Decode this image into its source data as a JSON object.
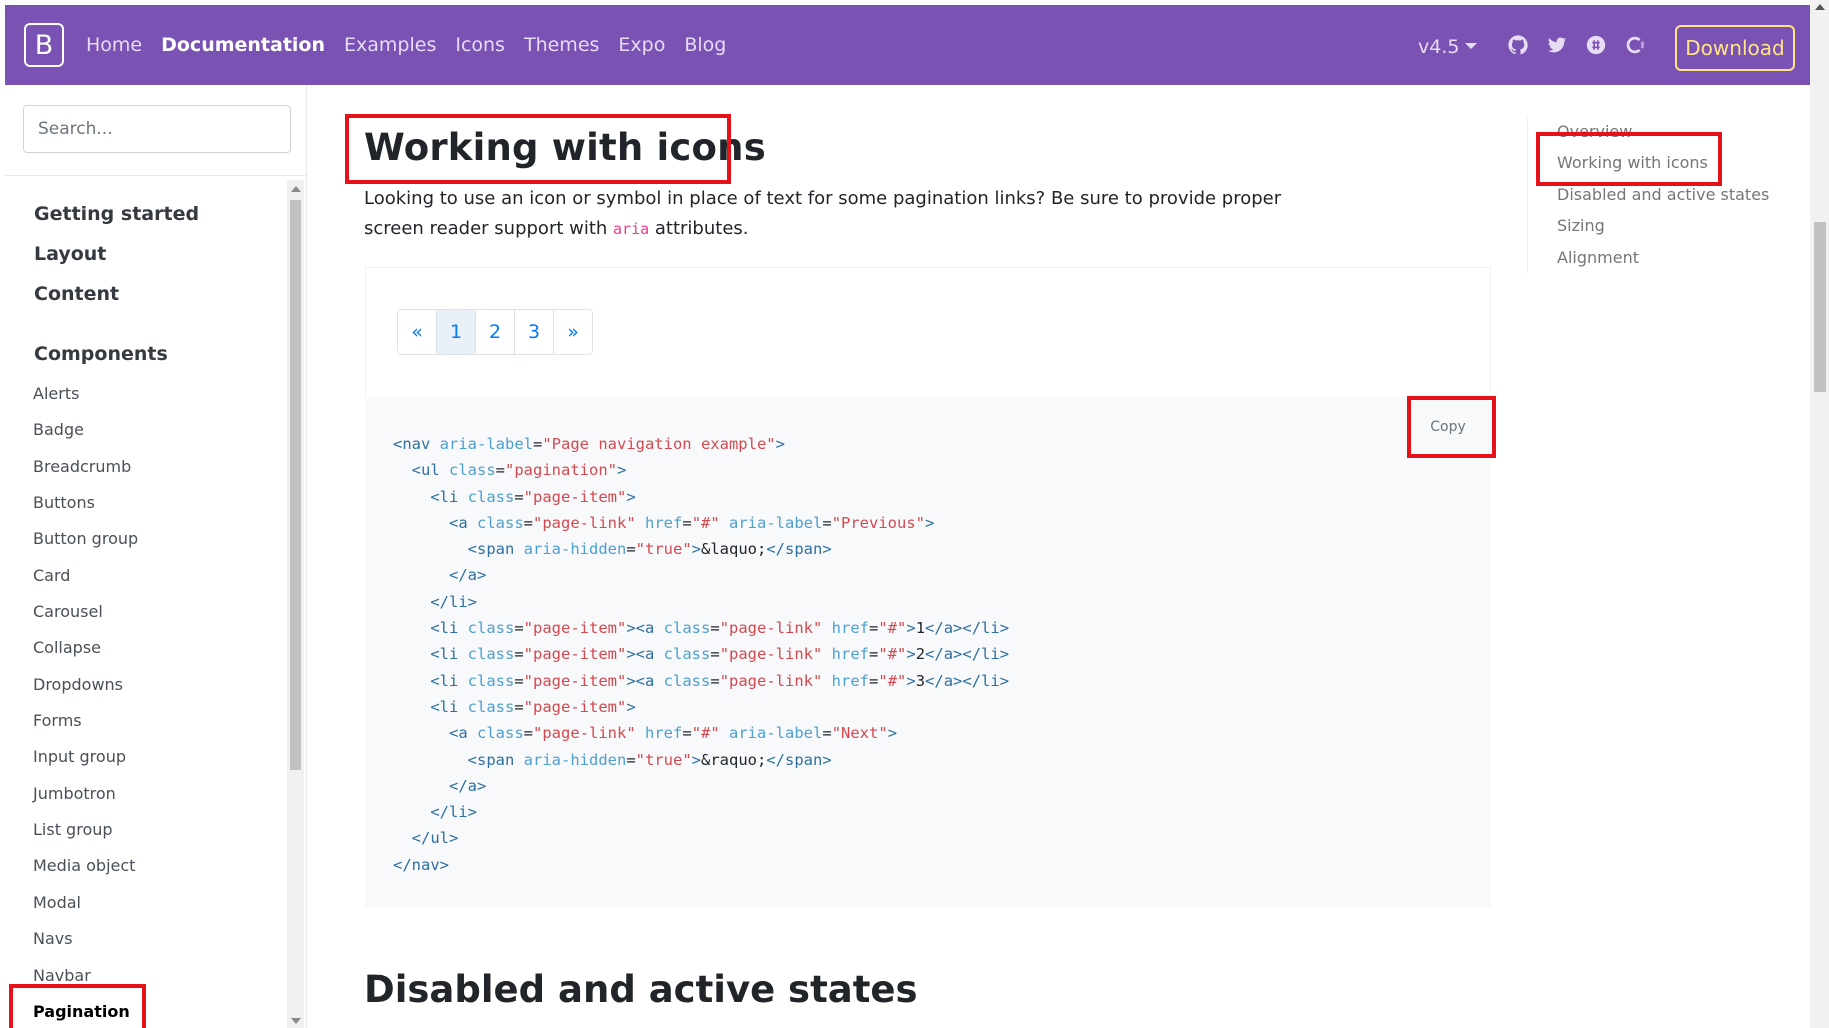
{
  "navbar": {
    "brand": "B",
    "links": [
      "Home",
      "Documentation",
      "Examples",
      "Icons",
      "Themes",
      "Expo",
      "Blog"
    ],
    "active_link": "Documentation",
    "version": "v4.5",
    "icons": [
      "github-icon",
      "twitter-icon",
      "slack-icon",
      "opencollective-icon"
    ],
    "download_label": "Download",
    "bg_color": "#7952b3"
  },
  "sidebar": {
    "search_placeholder": "Search...",
    "groups": [
      "Getting started",
      "Layout",
      "Content",
      "Components"
    ],
    "items": [
      "Alerts",
      "Badge",
      "Breadcrumb",
      "Buttons",
      "Button group",
      "Card",
      "Carousel",
      "Collapse",
      "Dropdowns",
      "Forms",
      "Input group",
      "Jumbotron",
      "List group",
      "Media object",
      "Modal",
      "Navs",
      "Navbar",
      "Pagination"
    ],
    "active_item": "Pagination"
  },
  "main": {
    "title": "Working with icons",
    "lead_before": "Looking to use an icon or symbol in place of text for some pagination links? Be sure to provide proper screen reader support with ",
    "lead_code": "aria",
    "lead_after": " attributes.",
    "pagination": [
      "«",
      "1",
      "2",
      "3",
      "»"
    ],
    "copy_label": "Copy",
    "code_lines": [
      "<nav aria-label=\"Page navigation example\">",
      "  <ul class=\"pagination\">",
      "    <li class=\"page-item\">",
      "      <a class=\"page-link\" href=\"#\" aria-label=\"Previous\">",
      "        <span aria-hidden=\"true\">&laquo;</span>",
      "      </a>",
      "    </li>",
      "    <li class=\"page-item\"><a class=\"page-link\" href=\"#\">1</a></li>",
      "    <li class=\"page-item\"><a class=\"page-link\" href=\"#\">2</a></li>",
      "    <li class=\"page-item\"><a class=\"page-link\" href=\"#\">3</a></li>",
      "    <li class=\"page-item\">",
      "      <a class=\"page-link\" href=\"#\" aria-label=\"Next\">",
      "        <span aria-hidden=\"true\">&raquo;</span>",
      "      </a>",
      "    </li>",
      "  </ul>",
      "</nav>"
    ],
    "next_heading": "Disabled and active states"
  },
  "toc": {
    "items": [
      "Overview",
      "Working with icons",
      "Disabled and active states",
      "Sizing",
      "Alignment"
    ],
    "active_item": "Working with icons"
  },
  "annotation_color": "#e5121c"
}
